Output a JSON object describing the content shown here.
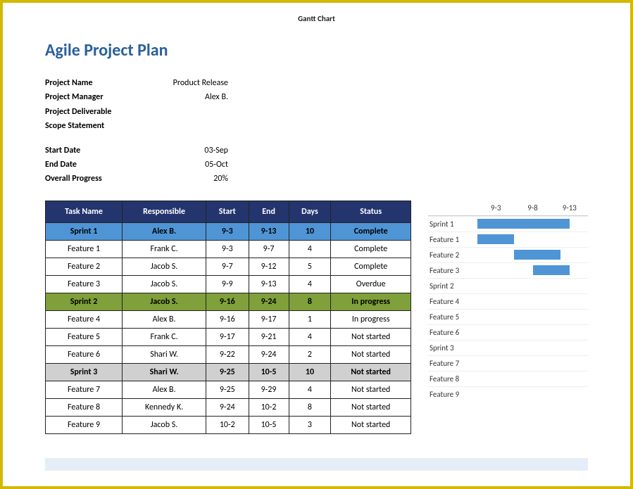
{
  "doc_title": "Gantt Chart",
  "main_title": "Agile Project Plan",
  "meta": {
    "project_name_label": "Project Name",
    "project_name_value": "Product Release",
    "project_manager_label": "Project Manager",
    "project_manager_value": "Alex B.",
    "project_deliverable_label": "Project Deliverable",
    "project_deliverable_value": "",
    "scope_statement_label": "Scope Statement",
    "scope_statement_value": "",
    "start_date_label": "Start Date",
    "start_date_value": "03-Sep",
    "end_date_label": "End Date",
    "end_date_value": "05-Oct",
    "overall_progress_label": "Overall Progress",
    "overall_progress_value": "20%"
  },
  "table": {
    "headers": {
      "task_name": "Task Name",
      "responsible": "Responsible",
      "start": "Start",
      "end": "End",
      "days": "Days",
      "status": "Status"
    },
    "rows": [
      {
        "type": "sprint1",
        "task": "Sprint 1",
        "resp": "Alex B.",
        "start": "9-3",
        "end": "9-13",
        "days": "10",
        "status": "Complete"
      },
      {
        "type": "",
        "task": "Feature 1",
        "resp": "Frank C.",
        "start": "9-3",
        "end": "9-7",
        "days": "4",
        "status": "Complete"
      },
      {
        "type": "",
        "task": "Feature 2",
        "resp": "Jacob S.",
        "start": "9-7",
        "end": "9-12",
        "days": "5",
        "status": "Complete"
      },
      {
        "type": "",
        "task": "Feature 3",
        "resp": "Jacob S.",
        "start": "9-9",
        "end": "9-13",
        "days": "4",
        "status": "Overdue"
      },
      {
        "type": "sprint2",
        "task": "Sprint 2",
        "resp": "Jacob S.",
        "start": "9-16",
        "end": "9-24",
        "days": "8",
        "status": "In progress"
      },
      {
        "type": "",
        "task": "Feature 4",
        "resp": "Alex B.",
        "start": "9-16",
        "end": "9-17",
        "days": "1",
        "status": "In progress"
      },
      {
        "type": "",
        "task": "Feature 5",
        "resp": "Frank C.",
        "start": "9-17",
        "end": "9-21",
        "days": "4",
        "status": "Not started"
      },
      {
        "type": "",
        "task": "Feature 6",
        "resp": "Shari W.",
        "start": "9-22",
        "end": "9-24",
        "days": "2",
        "status": "Not started"
      },
      {
        "type": "sprint3",
        "task": "Sprint 3",
        "resp": "Shari W.",
        "start": "9-25",
        "end": "10-5",
        "days": "10",
        "status": "Not started"
      },
      {
        "type": "",
        "task": "Feature 7",
        "resp": "Alex B.",
        "start": "9-25",
        "end": "9-29",
        "days": "4",
        "status": "Not started"
      },
      {
        "type": "",
        "task": "Feature 8",
        "resp": "Kennedy K.",
        "start": "9-24",
        "end": "10-2",
        "days": "8",
        "status": "Not started"
      },
      {
        "type": "",
        "task": "Feature 9",
        "resp": "Jacob S.",
        "start": "10-2",
        "end": "10-5",
        "days": "3",
        "status": "Not started"
      }
    ]
  },
  "chart_data": {
    "type": "gantt",
    "x_ticks": [
      "9-3",
      "9-8",
      "9-13"
    ],
    "x_range": [
      3,
      15
    ],
    "series": [
      {
        "name": "Sprint 1",
        "start": 3,
        "end": 13
      },
      {
        "name": "Feature 1",
        "start": 3,
        "end": 7
      },
      {
        "name": "Feature 2",
        "start": 7,
        "end": 12
      },
      {
        "name": "Feature 3",
        "start": 9,
        "end": 13
      },
      {
        "name": "Sprint 2",
        "start": null,
        "end": null
      },
      {
        "name": "Feature 4",
        "start": null,
        "end": null
      },
      {
        "name": "Feature 5",
        "start": null,
        "end": null
      },
      {
        "name": "Feature 6",
        "start": null,
        "end": null
      },
      {
        "name": "Sprint 3",
        "start": null,
        "end": null
      },
      {
        "name": "Feature 7",
        "start": null,
        "end": null
      },
      {
        "name": "Feature 8",
        "start": null,
        "end": null
      },
      {
        "name": "Feature 9",
        "start": null,
        "end": null
      }
    ]
  }
}
